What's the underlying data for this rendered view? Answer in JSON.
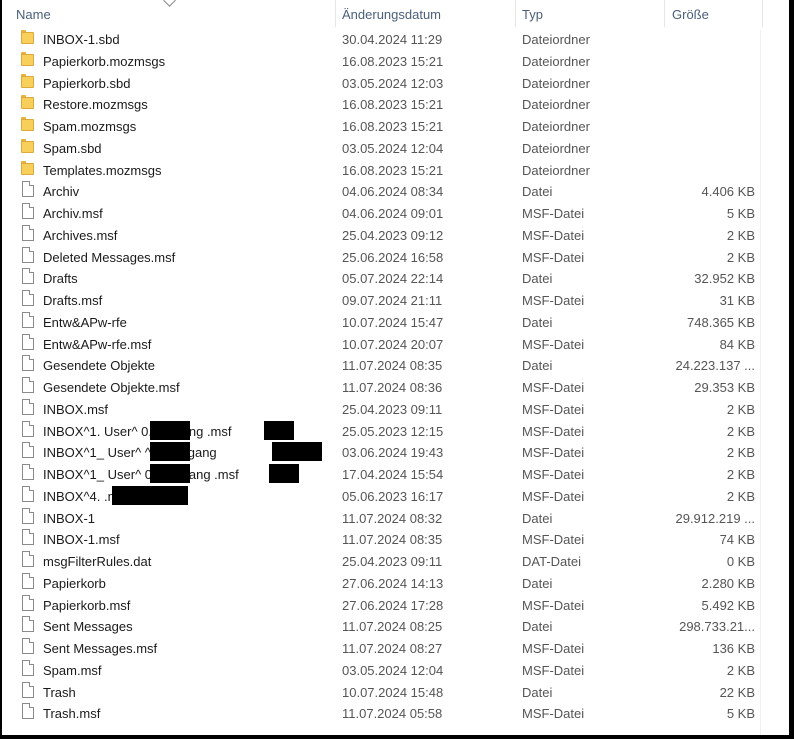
{
  "columns": {
    "name": "Name",
    "date": "Änderungsdatum",
    "type": "Typ",
    "size": "Größe"
  },
  "files": [
    {
      "icon": "folder-icon",
      "name": "INBOX-1.sbd",
      "date": "30.04.2024 11:29",
      "type": "Dateiordner",
      "size": ""
    },
    {
      "icon": "folder-icon",
      "name": "Papierkorb.mozmsgs",
      "date": "16.08.2023 15:21",
      "type": "Dateiordner",
      "size": ""
    },
    {
      "icon": "folder-icon",
      "name": "Papierkorb.sbd",
      "date": "03.05.2024 12:03",
      "type": "Dateiordner",
      "size": ""
    },
    {
      "icon": "folder-icon",
      "name": "Restore.mozmsgs",
      "date": "16.08.2023 15:21",
      "type": "Dateiordner",
      "size": ""
    },
    {
      "icon": "folder-icon",
      "name": "Spam.mozmsgs",
      "date": "16.08.2023 15:21",
      "type": "Dateiordner",
      "size": ""
    },
    {
      "icon": "folder-icon",
      "name": "Spam.sbd",
      "date": "03.05.2024 12:04",
      "type": "Dateiordner",
      "size": ""
    },
    {
      "icon": "folder-icon",
      "name": "Templates.mozmsgs",
      "date": "16.08.2023 15:21",
      "type": "Dateiordner",
      "size": ""
    },
    {
      "icon": "file-icon",
      "name": "Archiv",
      "date": "04.06.2024 08:34",
      "type": "Datei",
      "size": "4.406 KB"
    },
    {
      "icon": "file-icon",
      "name": "Archiv.msf",
      "date": "04.06.2024 09:01",
      "type": "MSF-Datei",
      "size": "5 KB"
    },
    {
      "icon": "file-icon",
      "name": "Archives.msf",
      "date": "25.04.2023 09:12",
      "type": "MSF-Datei",
      "size": "2 KB"
    },
    {
      "icon": "file-icon",
      "name": "Deleted Messages.msf",
      "date": "25.06.2024 16:58",
      "type": "MSF-Datei",
      "size": "2 KB"
    },
    {
      "icon": "file-icon",
      "name": "Drafts",
      "date": "05.07.2024 22:14",
      "type": "Datei",
      "size": "32.952 KB"
    },
    {
      "icon": "file-icon",
      "name": "Drafts.msf",
      "date": "09.07.2024 21:11",
      "type": "MSF-Datei",
      "size": "31 KB"
    },
    {
      "icon": "file-icon",
      "name": "Entw&APw-rfe",
      "date": "10.07.2024 15:47",
      "type": "Datei",
      "size": "748.365 KB"
    },
    {
      "icon": "file-icon",
      "name": "Entw&APw-rfe.msf",
      "date": "10.07.2024 20:07",
      "type": "MSF-Datei",
      "size": "84 KB"
    },
    {
      "icon": "file-icon",
      "name": "Gesendete Objekte",
      "date": "11.07.2024 08:35",
      "type": "Datei",
      "size": "24.223.137 ..."
    },
    {
      "icon": "file-icon",
      "name": "Gesendete Objekte.msf",
      "date": "11.07.2024 08:36",
      "type": "MSF-Datei",
      "size": "29.353 KB"
    },
    {
      "icon": "file-icon",
      "name": "INBOX.msf",
      "date": "25.04.2023 09:11",
      "type": "MSF-Datei",
      "size": "2 KB"
    },
    {
      "icon": "file-icon",
      "name": "INBOX^1. User^        0. Eingang        .msf",
      "date": "25.05.2023 12:15",
      "type": "MSF-Datei",
      "size": "2 KB"
    },
    {
      "icon": "file-icon",
      "name": "INBOX^1_ User^        ^0_ Eingang",
      "date": "03.06.2024 19:43",
      "type": "MSF-Datei",
      "size": "2 KB"
    },
    {
      "icon": "file-icon",
      "name": "INBOX^1_ User^        0_ Eingang        .msf",
      "date": "17.04.2024 15:54",
      "type": "MSF-Datei",
      "size": "2 KB"
    },
    {
      "icon": "file-icon",
      "name": "INBOX^4.                  .msf",
      "date": "05.06.2023 16:17",
      "type": "MSF-Datei",
      "size": "2 KB"
    },
    {
      "icon": "file-icon",
      "name": "INBOX-1",
      "date": "11.07.2024 08:32",
      "type": "Datei",
      "size": "29.912.219 ..."
    },
    {
      "icon": "file-icon",
      "name": "INBOX-1.msf",
      "date": "11.07.2024 08:35",
      "type": "MSF-Datei",
      "size": "74 KB"
    },
    {
      "icon": "file-icon",
      "name": "msgFilterRules.dat",
      "date": "25.04.2023 09:11",
      "type": "DAT-Datei",
      "size": "0 KB"
    },
    {
      "icon": "file-icon",
      "name": "Papierkorb",
      "date": "27.06.2024 14:13",
      "type": "Datei",
      "size": "2.280 KB"
    },
    {
      "icon": "file-icon",
      "name": "Papierkorb.msf",
      "date": "27.06.2024 17:28",
      "type": "MSF-Datei",
      "size": "5.492 KB"
    },
    {
      "icon": "file-icon",
      "name": "Sent Messages",
      "date": "11.07.2024 08:25",
      "type": "Datei",
      "size": "298.733.21..."
    },
    {
      "icon": "file-icon",
      "name": "Sent Messages.msf",
      "date": "11.07.2024 08:27",
      "type": "MSF-Datei",
      "size": "136 KB"
    },
    {
      "icon": "file-icon",
      "name": "Spam.msf",
      "date": "03.05.2024 12:04",
      "type": "MSF-Datei",
      "size": "2 KB"
    },
    {
      "icon": "file-icon",
      "name": "Trash",
      "date": "10.07.2024 15:48",
      "type": "Datei",
      "size": "22 KB"
    },
    {
      "icon": "file-icon",
      "name": "Trash.msf",
      "date": "11.07.2024 05:58",
      "type": "MSF-Datei",
      "size": "5 KB"
    }
  ]
}
